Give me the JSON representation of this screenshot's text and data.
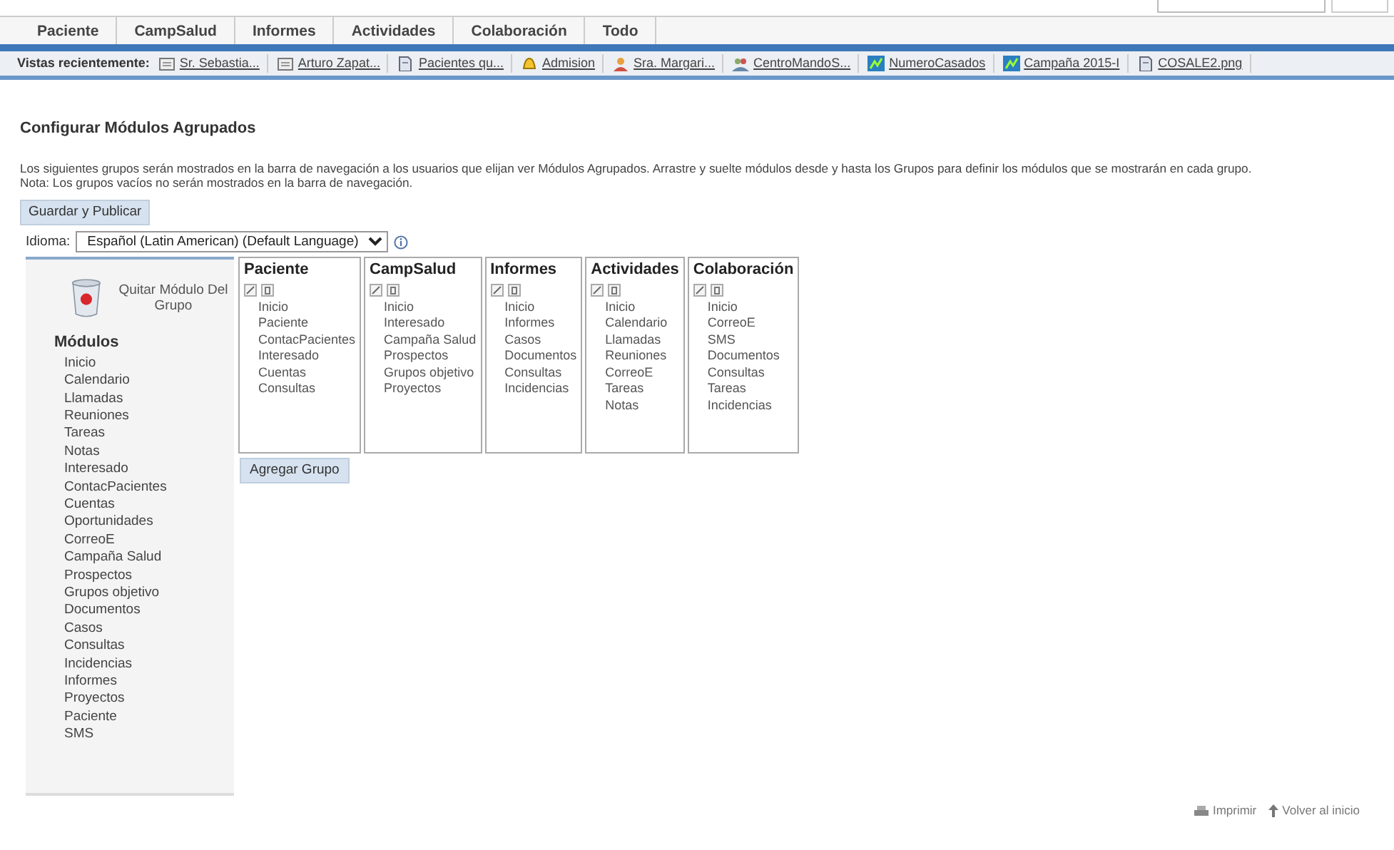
{
  "nav_tabs": [
    {
      "label": "Paciente",
      "selected": false
    },
    {
      "label": "CampSalud",
      "selected": false
    },
    {
      "label": "Informes",
      "selected": false
    },
    {
      "label": "Actividades",
      "selected": false
    },
    {
      "label": "Colaboración",
      "selected": false
    },
    {
      "label": "Todo",
      "selected": false
    }
  ],
  "recent_views": {
    "label": "Vistas recientemente:",
    "items": [
      {
        "label": "Sr. Sebastia...",
        "kind": "card"
      },
      {
        "label": "Arturo Zapat...",
        "kind": "card"
      },
      {
        "label": "Pacientes qu...",
        "kind": "document"
      },
      {
        "label": "Admision",
        "kind": "bell"
      },
      {
        "label": "Sra. Margari...",
        "kind": "person"
      },
      {
        "label": "CentroMandoS...",
        "kind": "group"
      },
      {
        "label": "NumeroCasados",
        "kind": "chart"
      },
      {
        "label": "Campaña 2015-I",
        "kind": "chart"
      },
      {
        "label": "COSALE2.png",
        "kind": "document"
      }
    ]
  },
  "page_title": "Configurar Módulos Agrupados",
  "description": [
    "Los siguientes grupos serán mostrados en la barra de navegación a los usuarios que elijan ver Módulos Agrupados. Arrastre y suelte módulos desde y hasta los Grupos para definir los módulos que se mostrarán en cada grupo.",
    "Nota: Los grupos vacíos no serán mostrados en la barra de navegación."
  ],
  "save_button": "Guardar y Publicar",
  "language": {
    "label": "Idioma:",
    "value": "Español (Latin American) (Default Language)"
  },
  "trash_label": "Quitar Módulo Del Grupo",
  "modules": {
    "title": "Módulos",
    "items": [
      "Inicio",
      "Calendario",
      "Llamadas",
      "Reuniones",
      "Tareas",
      "Notas",
      "Interesado",
      "ContacPacientes",
      "Cuentas",
      "Oportunidades",
      "CorreoE",
      "Campaña Salud",
      "Prospectos",
      "Grupos objetivo",
      "Documentos",
      "Casos",
      "Consultas",
      "Incidencias",
      "Informes",
      "Proyectos",
      "Paciente",
      "SMS"
    ]
  },
  "groups": [
    {
      "name": "Paciente",
      "modules": [
        "Inicio",
        "Paciente",
        "ContacPacientes",
        "Interesado",
        "Cuentas",
        "Consultas"
      ]
    },
    {
      "name": "CampSalud",
      "modules": [
        "Inicio",
        "Interesado",
        "Campaña Salud",
        "Prospectos",
        "Grupos objetivo",
        "Proyectos"
      ]
    },
    {
      "name": "Informes",
      "modules": [
        "Inicio",
        "Informes",
        "Casos",
        "Documentos",
        "Consultas",
        "Incidencias"
      ]
    },
    {
      "name": "Actividades",
      "modules": [
        "Inicio",
        "Calendario",
        "Llamadas",
        "Reuniones",
        "CorreoE",
        "Tareas",
        "Notas"
      ]
    },
    {
      "name": "Colaboración",
      "modules": [
        "Inicio",
        "CorreoE",
        "SMS",
        "Documentos",
        "Consultas",
        "Tareas",
        "Incidencias"
      ]
    }
  ],
  "add_group_button": "Agregar Grupo",
  "footer_links": [
    "Imprimir",
    "Volver al inicio"
  ]
}
